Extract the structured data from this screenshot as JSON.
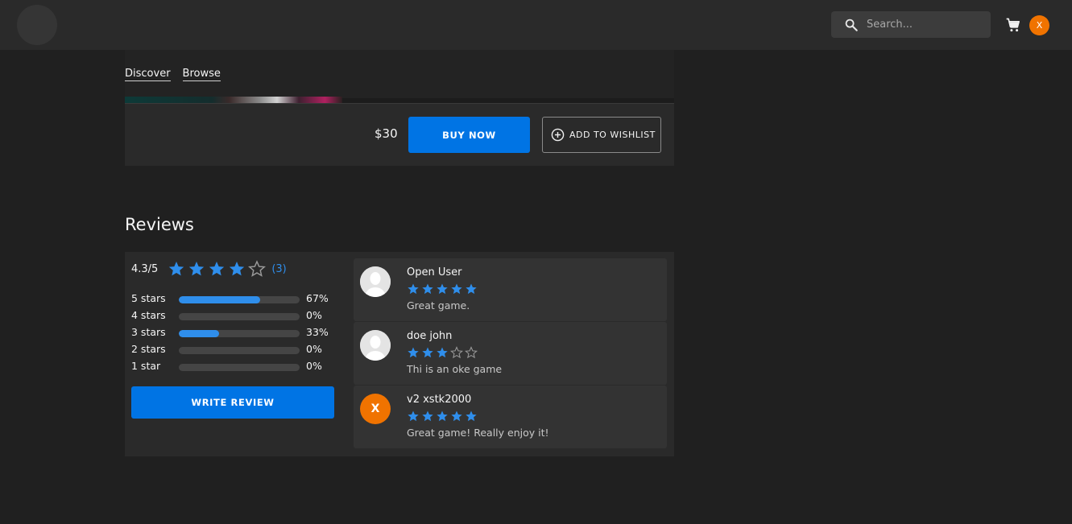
{
  "header": {
    "search_placeholder": "Search...",
    "user_initial": "X"
  },
  "nav": {
    "discover": "Discover",
    "browse": "Browse"
  },
  "purchase": {
    "price": "$30",
    "buy_label": "BUY NOW",
    "wishlist_label": "ADD TO WISHLIST"
  },
  "reviews": {
    "title": "Reviews",
    "average_text": "4.3/5",
    "average_value": 4.3,
    "count_text": "(3)",
    "distribution": [
      {
        "label": "5 stars",
        "pct_text": "67%",
        "fraction": 0.67
      },
      {
        "label": "4 stars",
        "pct_text": "0%",
        "fraction": 0
      },
      {
        "label": "3 stars",
        "pct_text": "33%",
        "fraction": 0.33
      },
      {
        "label": "2 stars",
        "pct_text": "0%",
        "fraction": 0
      },
      {
        "label": "1 star",
        "pct_text": "0%",
        "fraction": 0
      }
    ],
    "write_review_label": "WRITE REVIEW",
    "items": [
      {
        "name": "Open User",
        "rating": 5,
        "text": "Great game.",
        "avatar": "placeholder"
      },
      {
        "name": "doe john",
        "rating": 3,
        "text": "Thi is an oke game",
        "avatar": "placeholder"
      },
      {
        "name": "v2 xstk2000",
        "rating": 5,
        "text": "Great game! Really enjoy it!",
        "avatar": "initial",
        "initial": "X"
      }
    ]
  },
  "colors": {
    "accent": "#0074e4",
    "star": "#2f8eeb",
    "avatar_orange": "#f07300"
  }
}
